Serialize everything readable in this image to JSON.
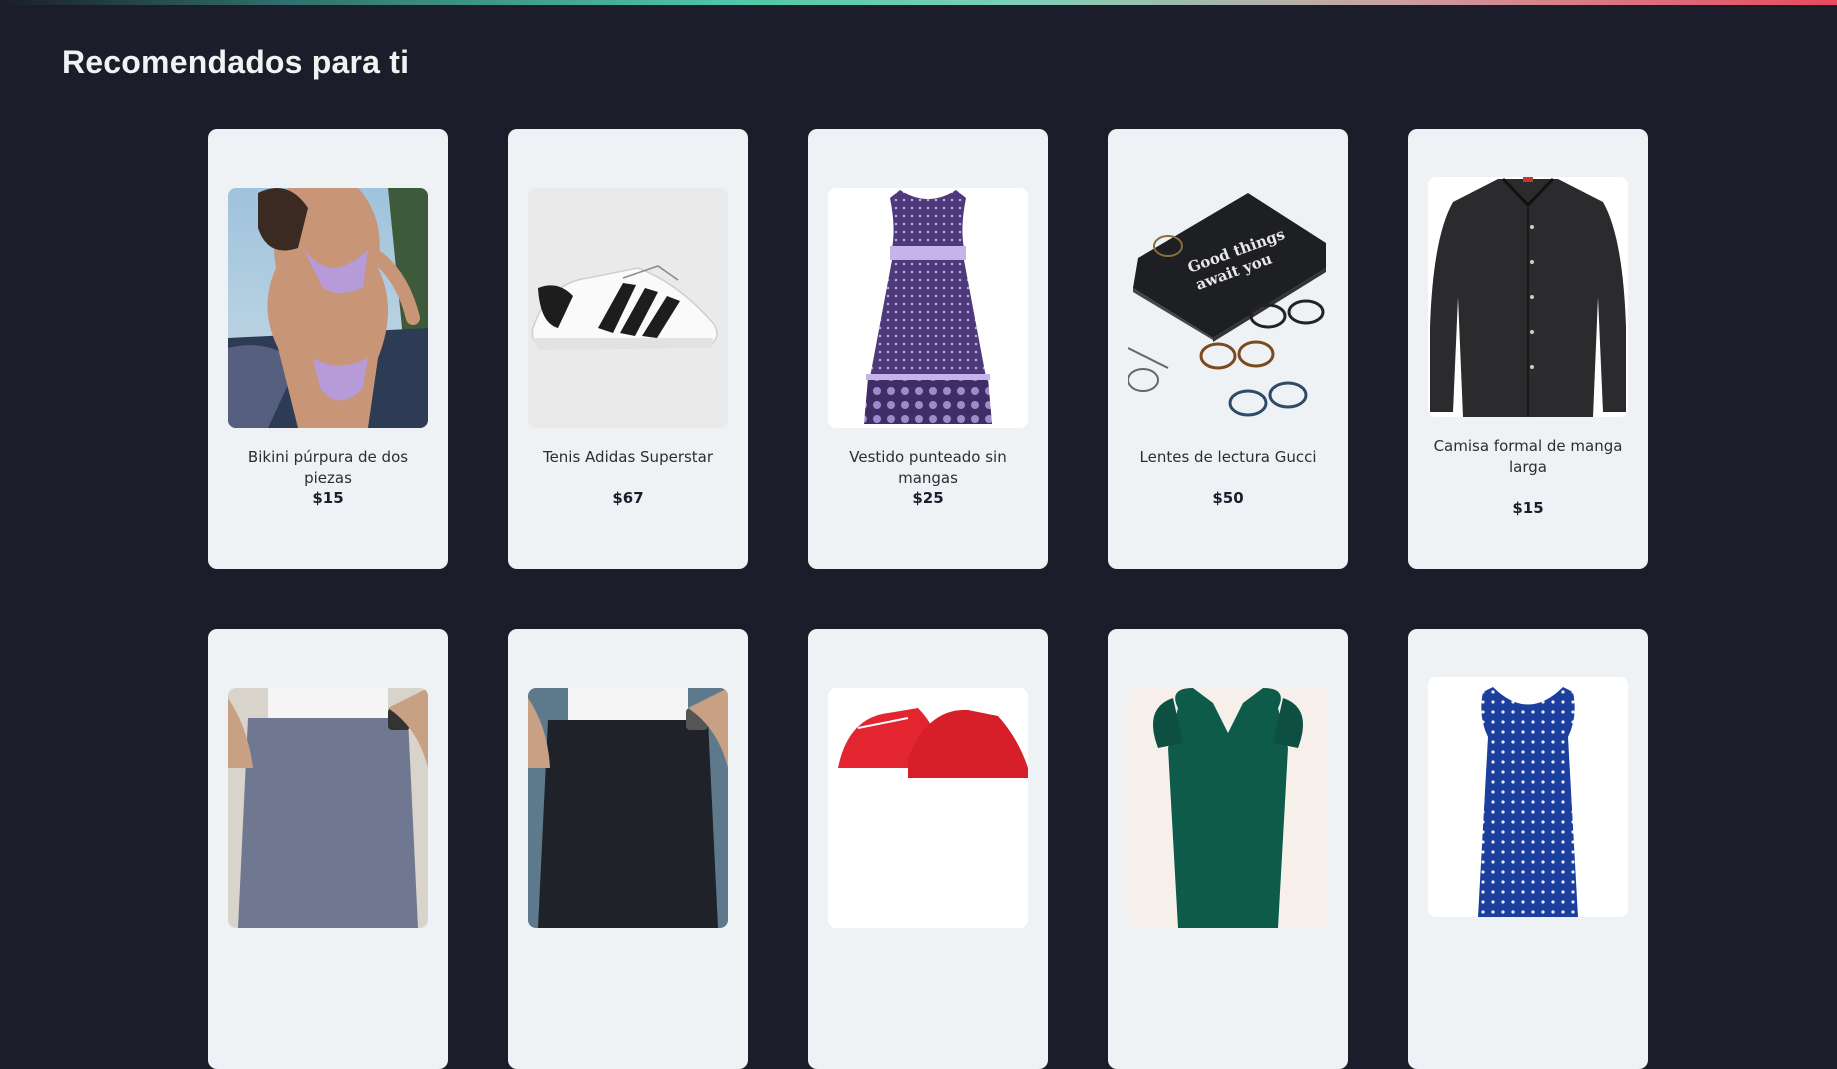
{
  "section": {
    "title": "Recomendados para ti"
  },
  "products_row1": [
    {
      "name": "Bikini púrpura de dos piezas",
      "price": "$15",
      "image": "purple-bikini-photo"
    },
    {
      "name": "Tenis Adidas Superstar",
      "price": "$67",
      "image": "adidas-superstar-sneaker-photo"
    },
    {
      "name": "Vestido punteado sin mangas",
      "price": "$25",
      "image": "dotted-sleeveless-dress-photo"
    },
    {
      "name": "Lentes de lectura Gucci",
      "price": "$50",
      "image": "reading-glasses-box-photo"
    },
    {
      "name": "Camisa formal de manga larga",
      "price": "$15",
      "image": "black-dress-shirt-photo"
    }
  ],
  "products_row2": [
    {
      "image": "grey-pants-photo"
    },
    {
      "image": "black-pants-photo"
    },
    {
      "image": "red-sneakers-photo"
    },
    {
      "image": "green-dress-photo"
    },
    {
      "image": "blue-dotted-top-photo"
    }
  ],
  "colors": {
    "background": "#1b1d2a",
    "card": "#eef2f5",
    "title": "#f2f2f2",
    "accent_gradient_start": "#4fc7a8",
    "accent_gradient_end": "#e84a5f"
  }
}
